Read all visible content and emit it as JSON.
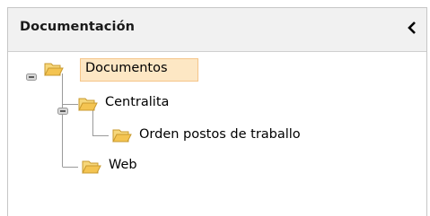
{
  "panel": {
    "title": "Documentación",
    "collapse_icon": "chevron-left-icon"
  },
  "tree": {
    "nodes": [
      {
        "label": "Documentos",
        "level": 0,
        "expanded": true,
        "selected": true,
        "icon": "folder-open-icon"
      },
      {
        "label": "Centralita",
        "level": 1,
        "expanded": true,
        "selected": false,
        "icon": "folder-open-icon"
      },
      {
        "label": "Orden postos de traballo",
        "level": 2,
        "expanded": false,
        "selected": false,
        "icon": "folder-open-icon"
      },
      {
        "label": "Web",
        "level": 1,
        "expanded": false,
        "selected": false,
        "icon": "folder-open-icon"
      }
    ]
  },
  "colors": {
    "selection_bg": "#fde7c4",
    "selection_border": "#f5c58a",
    "folder": "#f4c451",
    "header_bg": "#f1f1f1"
  }
}
